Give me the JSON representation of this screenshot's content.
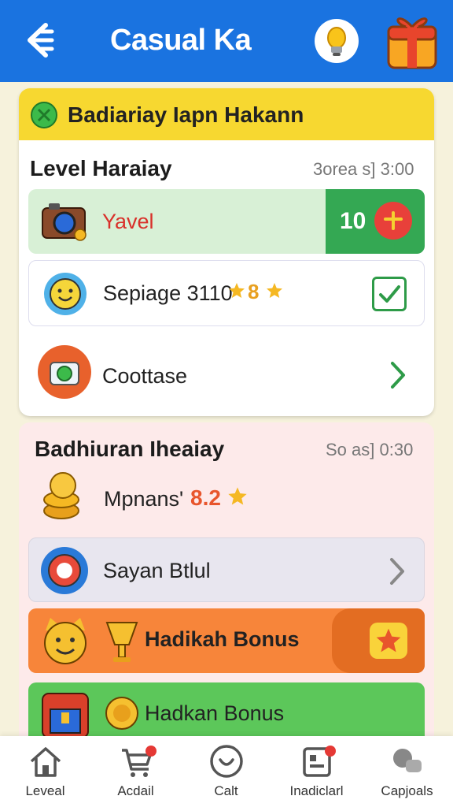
{
  "header": {
    "title": "Casual Ka"
  },
  "banner": {
    "text": "Badiariay Iapn Hakann"
  },
  "section1": {
    "title": "Level Haraiay",
    "time": "3orea s] 3:00",
    "rows": [
      {
        "label": "Yavel",
        "badge_value": "10",
        "badge_symbol": "+"
      },
      {
        "label": "Sepiage 3110",
        "rating_text": "8",
        "checked": true
      },
      {
        "label": "Coottase"
      }
    ]
  },
  "section2": {
    "title": "Badhiuran Iheaiay",
    "time": "So as] 0:30",
    "rating_row": {
      "label": "Mpnans'",
      "value": "8.2"
    },
    "rows": [
      {
        "label": "Sayan Btlul"
      },
      {
        "label": "Hadikah Bonus"
      },
      {
        "label": "Hadkan Bonus"
      }
    ]
  },
  "nav": [
    {
      "label": "Leveal",
      "icon": "home-icon"
    },
    {
      "label": "Acdail",
      "icon": "cart-icon"
    },
    {
      "label": "Calt",
      "icon": "chat-icon"
    },
    {
      "label": "Inadiclarl",
      "icon": "calendar-icon"
    },
    {
      "label": "Capjoals",
      "icon": "chat-bubbles-icon"
    }
  ],
  "colors": {
    "primary": "#1a73e0",
    "banner": "#f7d830",
    "success": "#34a853",
    "orange": "#f7853a",
    "green": "#5cc75a"
  }
}
